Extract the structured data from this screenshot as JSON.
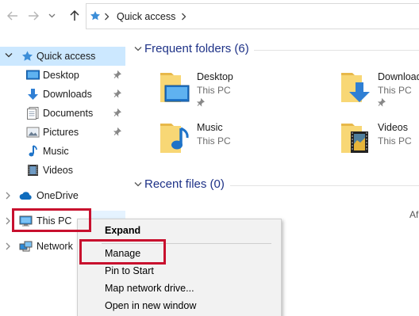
{
  "navbar": {
    "back_icon": "arrow-left-icon",
    "forward_icon": "arrow-right-icon",
    "history_icon": "chevron-down-icon",
    "up_icon": "arrow-up-icon",
    "address": {
      "icon": "star-icon",
      "crumb": "Quick access"
    }
  },
  "sidebar": {
    "items": [
      {
        "label": "Quick access",
        "icon": "star-icon",
        "selected": true
      },
      {
        "label": "Desktop",
        "icon": "desktop-folder-icon",
        "pinned": true
      },
      {
        "label": "Downloads",
        "icon": "download-arrow-icon",
        "pinned": true
      },
      {
        "label": "Documents",
        "icon": "documents-icon",
        "pinned": true
      },
      {
        "label": "Pictures",
        "icon": "pictures-icon",
        "pinned": true
      },
      {
        "label": "Music",
        "icon": "music-note-icon"
      },
      {
        "label": "Videos",
        "icon": "film-strip-icon"
      },
      {
        "label": "OneDrive",
        "icon": "cloud-icon"
      },
      {
        "label": "This PC",
        "icon": "computer-icon"
      },
      {
        "label": "Network",
        "icon": "network-icon"
      }
    ]
  },
  "content": {
    "frequent": {
      "title": "Frequent folders (6)",
      "folders": [
        {
          "name": "Desktop",
          "location": "This PC",
          "pinned": true
        },
        {
          "name": "Download",
          "location": "This PC",
          "pinned": true
        },
        {
          "name": "Music",
          "location": "This PC"
        },
        {
          "name": "Videos",
          "location": "This PC"
        }
      ]
    },
    "recent": {
      "title": "Recent files (0)"
    },
    "trailing_text": "Af"
  },
  "context_menu": {
    "items": [
      "Expand",
      "Manage",
      "Pin to Start",
      "Map network drive...",
      "Open in new window"
    ]
  },
  "colors": {
    "selected_bg": "#cce8ff",
    "header_text": "#1e3287",
    "highlight_red": "#c8102e",
    "folder_yellow": "#f8d775"
  }
}
